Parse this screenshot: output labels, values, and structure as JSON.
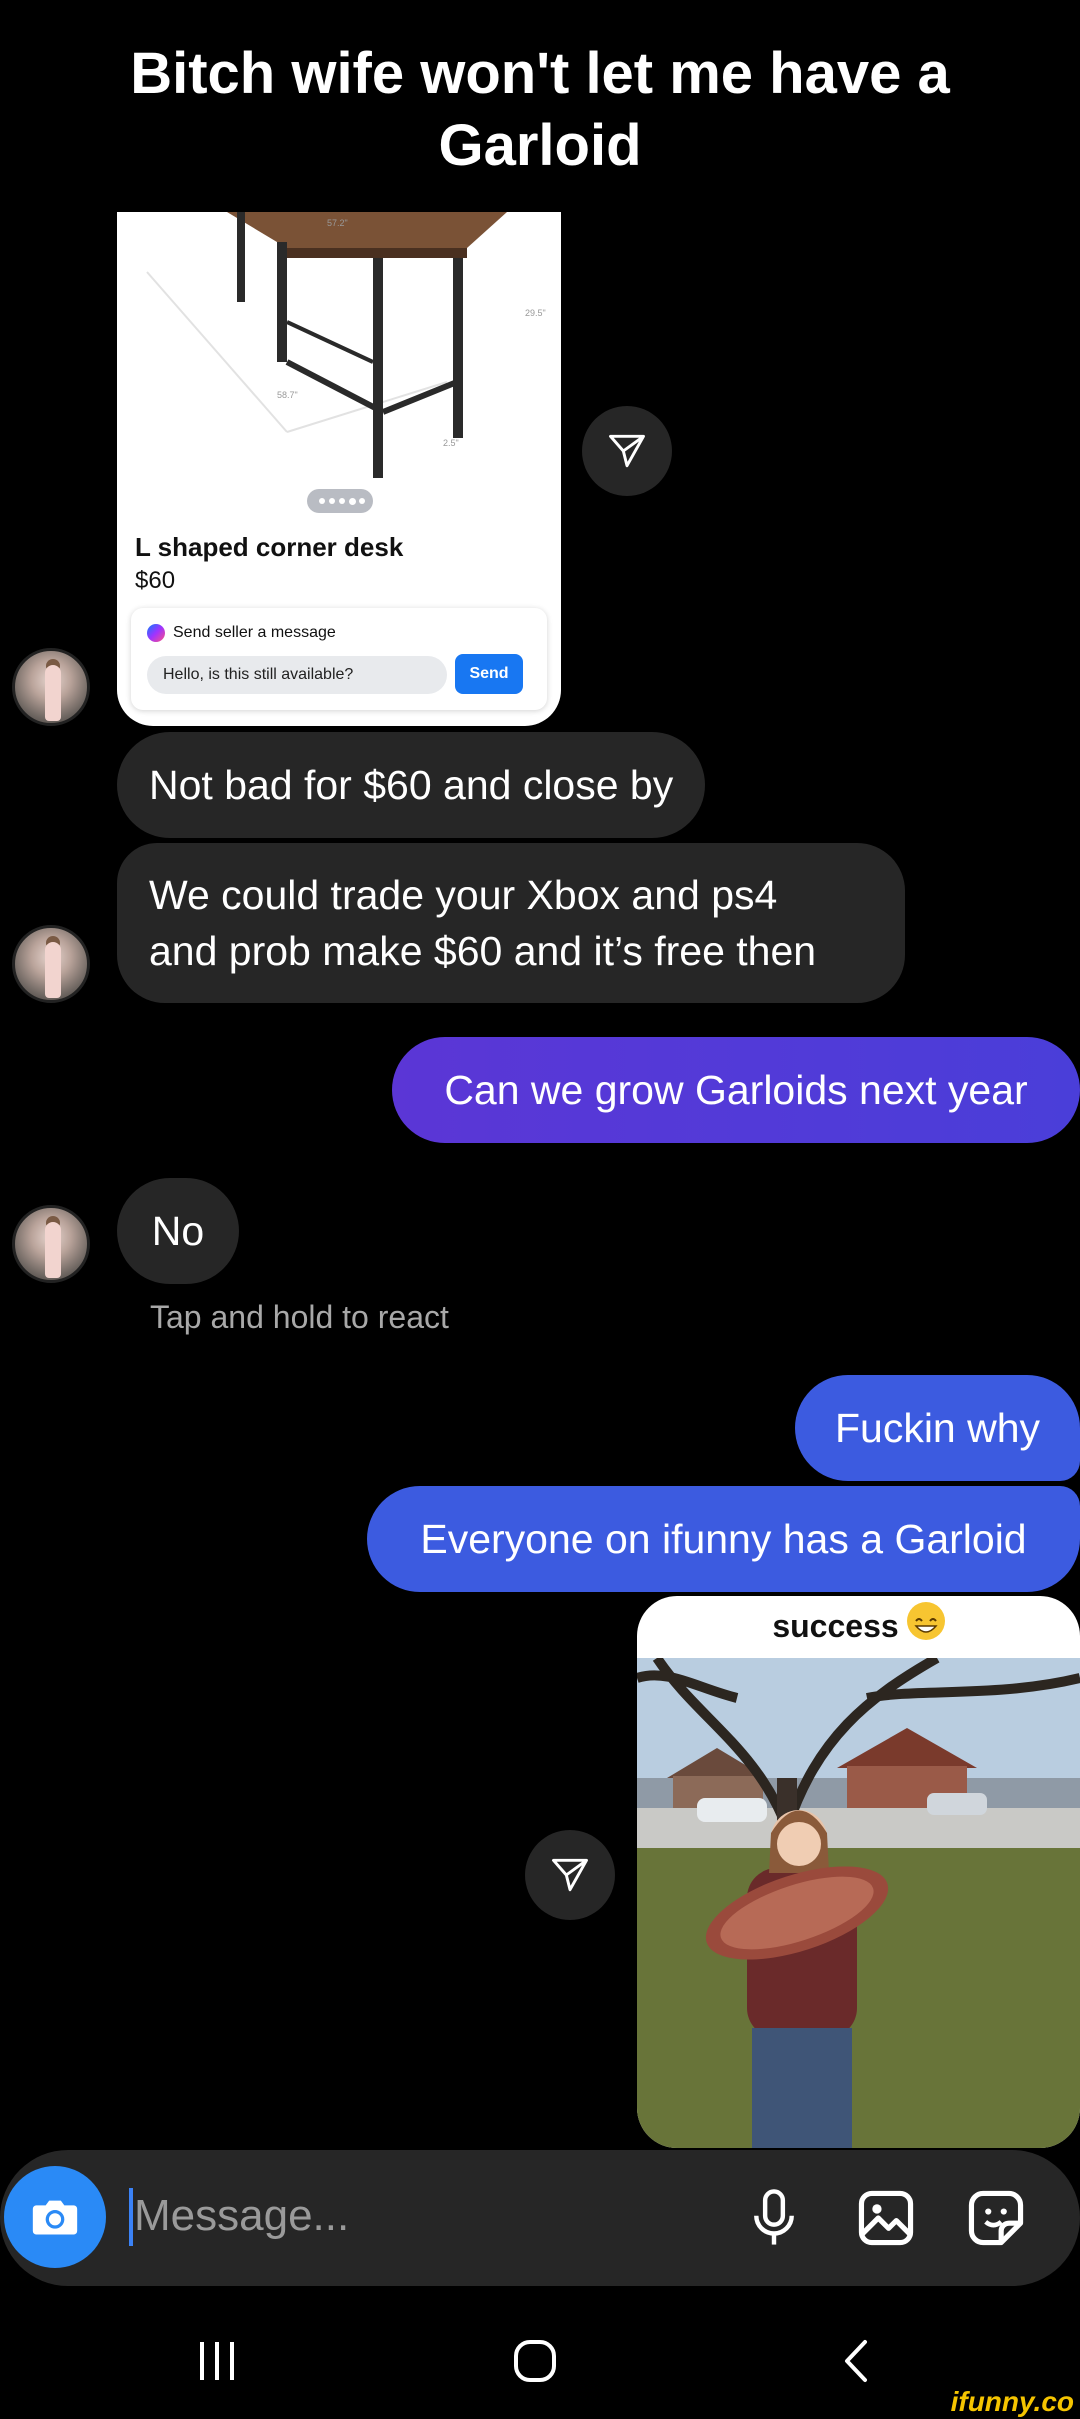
{
  "meme": {
    "title": "Bitch wife won't let me have a Garloid"
  },
  "chat": {
    "listing": {
      "title": "L shaped corner desk",
      "price": "$60",
      "seller_prompt": "Send seller a message",
      "input_value": "Hello, is this still available?",
      "send_label": "Send",
      "dimensions": [
        "57.2\"",
        "29.5\"",
        "58.7\"",
        "2.5\""
      ]
    },
    "messages": [
      {
        "side": "received",
        "text": "Not bad for $60 and close by"
      },
      {
        "side": "received",
        "lines": [
          "We could trade your Xbox and ps4",
          "and prob make $60 and it’s free then"
        ]
      },
      {
        "side": "sent",
        "text": "Can we grow Garloids next year"
      },
      {
        "side": "received",
        "text": "No"
      },
      {
        "side": "sent",
        "text": "Fuckin why"
      },
      {
        "side": "sent",
        "text": "Everyone on ifunny has a Garloid"
      }
    ],
    "react_hint": "Tap and hold to react",
    "shared_photo": {
      "caption": "success",
      "emoji": "grinning-face"
    }
  },
  "composer": {
    "placeholder": "Message...",
    "icons": [
      "camera-icon",
      "microphone-icon",
      "gallery-icon",
      "sticker-icon"
    ]
  },
  "system_nav": {
    "icons": [
      "recents-icon",
      "home-icon",
      "back-icon"
    ]
  },
  "watermark": "ifunny.co",
  "colors": {
    "background": "#000000",
    "received_bubble": "#262626",
    "sent_bubble_purple": "#5b36d6",
    "sent_bubble_blue": "#3c5be0",
    "camera_button": "#2a8af6",
    "messenger_send": "#1877f2",
    "watermark": "#f5c400"
  }
}
